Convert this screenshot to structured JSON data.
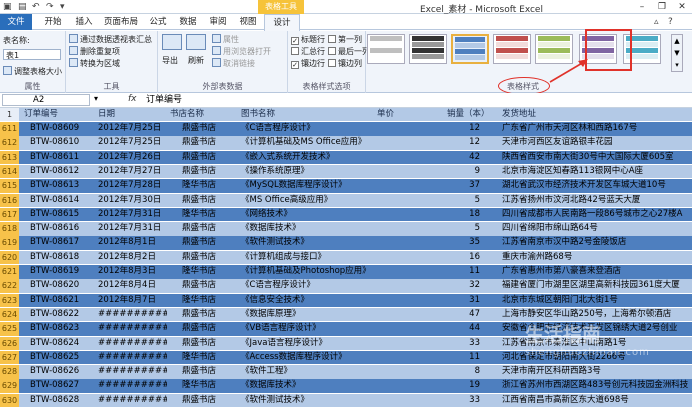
{
  "title_bar": {
    "window_title": "Excel_素材 - Microsoft Excel",
    "context_group": "表格工具",
    "window_controls": [
      "minimize-icon",
      "restore-icon",
      "close-icon"
    ]
  },
  "tabs": [
    "文件",
    "开始",
    "插入",
    "页面布局",
    "公式",
    "数据",
    "审阅",
    "视图",
    "设计"
  ],
  "ribbon": {
    "properties": {
      "name_label": "表名称:",
      "name_value": "表1",
      "resize": "调整表格大小",
      "group": "属性"
    },
    "tools": {
      "pivot": "通过数据透视表汇总",
      "remove_dup": "删除重复项",
      "to_range": "转换为区域",
      "group": "工具"
    },
    "external": {
      "export": "导出",
      "refresh": "刷新",
      "props": "属性",
      "open_browser": "用浏览器打开",
      "unlink": "取消链接",
      "group": "外部表数据"
    },
    "options": {
      "header_row": "标题行",
      "total_row": "汇总行",
      "banded_rows": "镶边行",
      "first_col": "第一列",
      "last_col": "最后一列",
      "banded_cols": "镶边列",
      "group": "表格样式选项"
    },
    "styles": {
      "group": "表格样式"
    }
  },
  "formula_bar": {
    "cell_ref": "A2",
    "fx": "fx",
    "content": "订单编号"
  },
  "table": {
    "header_row_num": "1",
    "headers": [
      "订单编号",
      "日期",
      "书店名称",
      "图书名称",
      "单价",
      "销量（本）",
      "发货地址"
    ],
    "rows": [
      [
        "611",
        "BTW-08609",
        "2012年7月25日",
        "鼎盛书店",
        "《C语言程序设计》",
        "",
        "12",
        "广东省广州市天河区林和西路167号"
      ],
      [
        "612",
        "BTW-08610",
        "2012年7月25日",
        "鼎盛书店",
        "《计算机基础及MS Office应用》",
        "",
        "12",
        "天津市河西区友谊路银丰花园"
      ],
      [
        "613",
        "BTW-08611",
        "2012年7月26日",
        "鼎盛书店",
        "《嵌入式系统开发技术》",
        "",
        "42",
        "陕西省西安市南大街30号中大国际大厦605室"
      ],
      [
        "614",
        "BTW-08612",
        "2012年7月27日",
        "鼎盛书店",
        "《操作系统原理》",
        "",
        "9",
        "北京市海淀区知春路113银网中心A座"
      ],
      [
        "615",
        "BTW-08613",
        "2012年7月28日",
        "隆华书店",
        "《MySQL数据库程序设计》",
        "",
        "37",
        "湖北省武汉市经济技术开发区车城大道10号"
      ],
      [
        "616",
        "BTW-08614",
        "2012年7月30日",
        "鼎盛书店",
        "《MS Office高级应用》",
        "",
        "5",
        "江苏省扬州市汶河北路42号蓝天大厦"
      ],
      [
        "617",
        "BTW-08615",
        "2012年7月31日",
        "隆华书店",
        "《网络技术》",
        "",
        "18",
        "四川省成都市人民南路一段86号城市之心27楼A"
      ],
      [
        "618",
        "BTW-08616",
        "2012年7月31日",
        "鼎盛书店",
        "《数据库技术》",
        "",
        "5",
        "四川省绵阳市绵山路64号"
      ],
      [
        "619",
        "BTW-08617",
        "2012年8月1日",
        "鼎盛书店",
        "《软件测试技术》",
        "",
        "35",
        "江苏省南京市汉中路2号金陵饭店"
      ],
      [
        "620",
        "BTW-08618",
        "2012年8月2日",
        "鼎盛书店",
        "《计算机组成与接口》",
        "",
        "16",
        "重庆市渝州路68号"
      ],
      [
        "621",
        "BTW-08619",
        "2012年8月3日",
        "隆华书店",
        "《计算机基础及Photoshop应用》",
        "",
        "11",
        "广东省惠州市第八豪喜来登酒店"
      ],
      [
        "622",
        "BTW-08620",
        "2012年8月4日",
        "鼎盛书店",
        "《C语言程序设计》",
        "",
        "32",
        "福建省厦门市湖里区湖里高新科技园361度大厦"
      ],
      [
        "623",
        "BTW-08621",
        "2012年8月7日",
        "隆华书店",
        "《信息安全技术》",
        "",
        "31",
        "北京市东城区朝阳门北大街1号"
      ],
      [
        "624",
        "BTW-08622",
        "############",
        "鼎盛书店",
        "《数据库原理》",
        "",
        "47",
        "上海市静安区华山路250号，上海希尔顿酒店"
      ],
      [
        "625",
        "BTW-08623",
        "############",
        "鼎盛书店",
        "《VB语言程序设计》",
        "",
        "44",
        "安徽省合肥市经济技术开发区锦绣大道2号创业"
      ],
      [
        "626",
        "BTW-08624",
        "############",
        "鼎盛书店",
        "《Java语言程序设计》",
        "",
        "33",
        "江苏省南京市秦淮区中山南路1号"
      ],
      [
        "627",
        "BTW-08625",
        "############",
        "隆华书店",
        "《Access数据库程序设计》",
        "",
        "11",
        "河北省保定市朝阳南大街2266号"
      ],
      [
        "628",
        "BTW-08626",
        "############",
        "鼎盛书店",
        "《软件工程》",
        "",
        "8",
        "天津市南开区科研西路3号"
      ],
      [
        "629",
        "BTW-08627",
        "############",
        "隆华书店",
        "《数据库技术》",
        "",
        "19",
        "浙江省苏州市西湖区路483号创元科技园金洲科技"
      ],
      [
        "630",
        "BTW-08628",
        "############",
        "鼎盛书店",
        "《软件测试技术》",
        "",
        "33",
        "江西省南昌市高新区东大道698号"
      ]
    ]
  },
  "watermark": {
    "main": "生活指南",
    "sub": "shenghuozhinan.com"
  },
  "colors": {
    "band_dark": "#4e7fbf",
    "band_light": "#b3c9e6",
    "accent": "#2a6ebb",
    "highlight": "#e0322a"
  }
}
